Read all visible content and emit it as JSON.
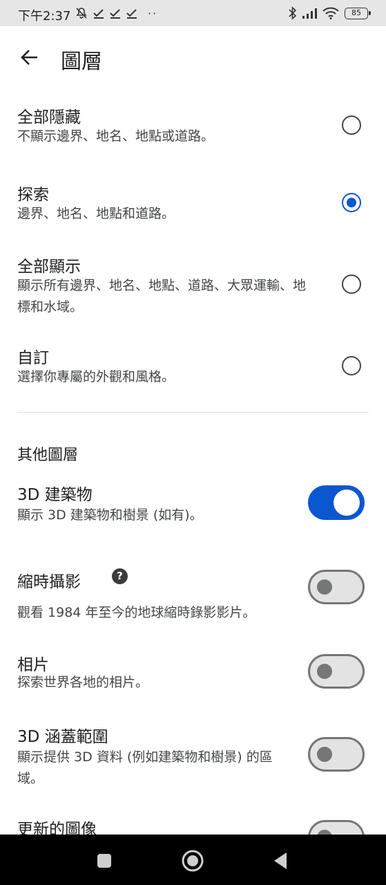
{
  "status_bar": {
    "time": "下午2:37",
    "battery": "85",
    "icons_left": [
      "mute-icon",
      "check-icon",
      "check-icon",
      "check-icon",
      "more-dots-icon"
    ],
    "icons_right": [
      "bluetooth-icon",
      "signal-icon",
      "wifi-icon",
      "battery-icon"
    ]
  },
  "header": {
    "title": "圖層",
    "back_icon": "arrow-back-icon"
  },
  "map_type_options": [
    {
      "title": "全部隱藏",
      "description": "不顯示邊界、地名、地點或道路。",
      "selected": false
    },
    {
      "title": "探索",
      "description": "邊界、地名、地點和道路。",
      "selected": true
    },
    {
      "title": "全部顯示",
      "description": "顯示所有邊界、地名、地點、道路、大眾運輸、地標和水域。",
      "selected": false
    },
    {
      "title": "自訂",
      "description": "選擇你專屬的外觀和風格。",
      "selected": false
    }
  ],
  "other_layers": {
    "section_title": "其他圖層",
    "items": [
      {
        "title": "3D 建築物",
        "description": "顯示 3D 建築物和樹景 (如有)。",
        "enabled": true
      },
      {
        "title": "縮時攝影",
        "description": "觀看 1984 年至今的地球縮時錄影影片。",
        "enabled": false,
        "help_icon": "?"
      },
      {
        "title": "相片",
        "description": "探索世界各地的相片。",
        "enabled": false
      },
      {
        "title": "3D 涵蓋範圍",
        "description": "顯示提供 3D 資料 (例如建築物和樹景) 的區域。",
        "enabled": false
      },
      {
        "title": "更新的圖像",
        "enabled": false
      }
    ]
  },
  "colors": {
    "accent": "#0b57d0",
    "toggle_off_track": "#e3e3e3",
    "toggle_off_outline": "#747775",
    "status_bar_bg": "#e6e6e6",
    "nav_bar_bg": "#000000"
  },
  "nav_bar": {
    "buttons": [
      "recents-square-icon",
      "home-circle-icon",
      "back-triangle-icon"
    ]
  }
}
